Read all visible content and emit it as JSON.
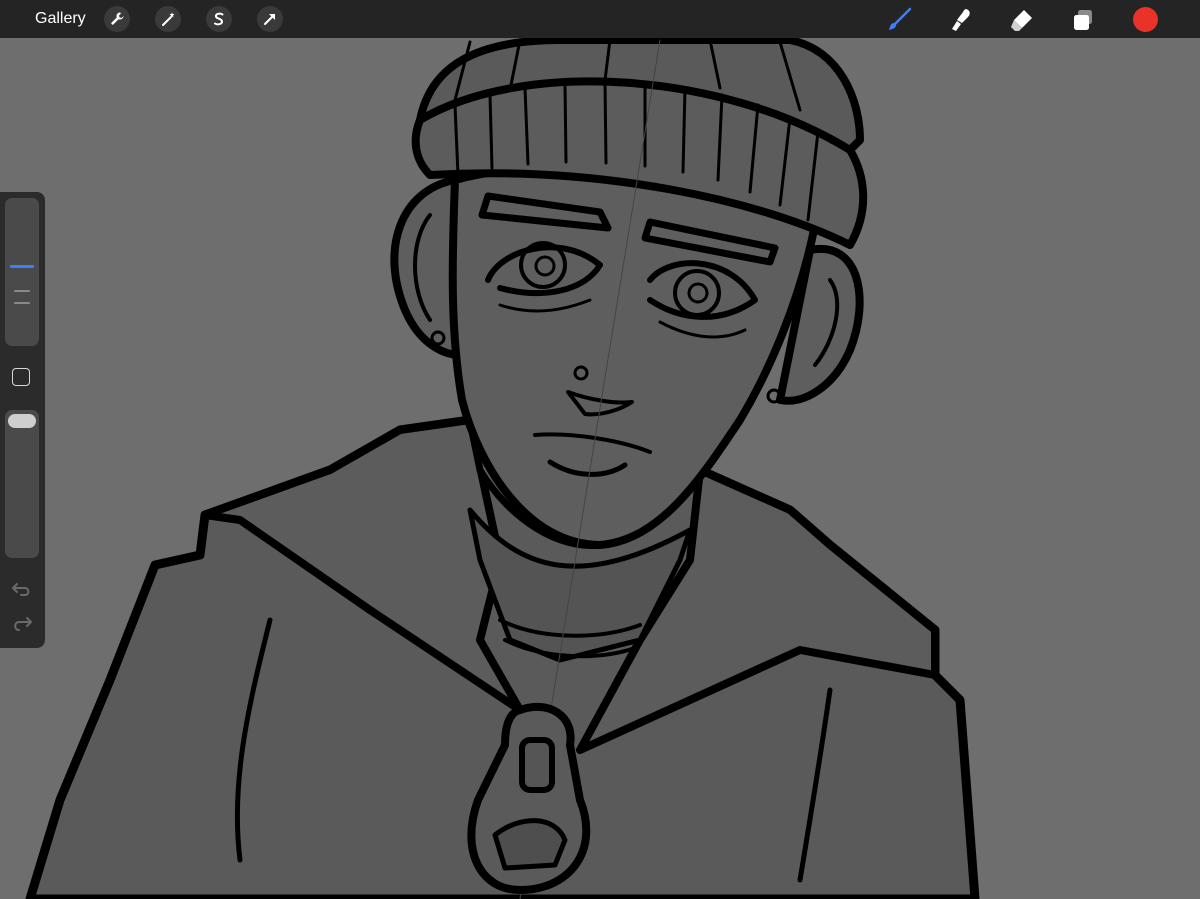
{
  "topbar": {
    "gallery_label": "Gallery",
    "left_tools": [
      "wrench-icon",
      "magic-wand-icon",
      "selection-s-icon",
      "transform-arrow-icon"
    ],
    "right_tools": [
      "brush-icon",
      "smudge-icon",
      "eraser-icon",
      "layers-icon"
    ],
    "active_tool": "brush-icon",
    "active_tool_color": "#3d7dff",
    "current_color": "#e8322a"
  },
  "sidebar": {
    "brush_size_level": 0.55,
    "opacity_level": 1.0,
    "controls": [
      "size-slider",
      "modify-button",
      "opacity-slider",
      "undo-icon",
      "redo-icon"
    ]
  },
  "canvas": {
    "background": "#6e6e6e",
    "fill": "#5a5a5a",
    "line_color": "#000000",
    "content": "drawing"
  }
}
